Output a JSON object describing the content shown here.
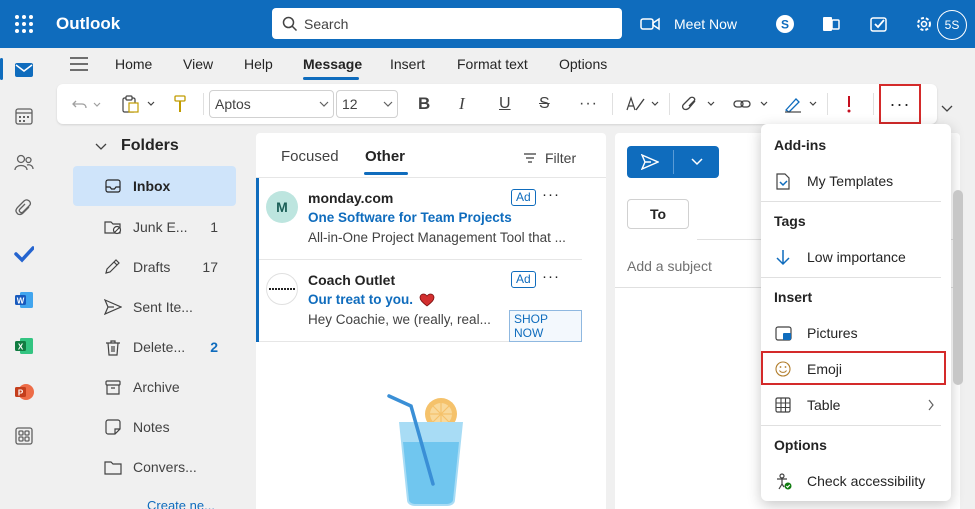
{
  "app": {
    "name": "Outlook",
    "avatar_initials": "5S"
  },
  "search": {
    "placeholder": "Search"
  },
  "topbar": {
    "meet_now": "Meet Now"
  },
  "ribbon_tabs": [
    "Home",
    "View",
    "Help",
    "Message",
    "Insert",
    "Format text",
    "Options"
  ],
  "ribbon_active_tab": "Message",
  "toolbar": {
    "font": "Aptos",
    "size": "12",
    "more": "···"
  },
  "folders": {
    "header": "Folders",
    "items": [
      {
        "label": "Inbox",
        "count": "",
        "icon": "inbox-icon"
      },
      {
        "label": "Junk E...",
        "count": "1",
        "icon": "junk-icon"
      },
      {
        "label": "Drafts",
        "count": "17",
        "icon": "drafts-icon"
      },
      {
        "label": "Sent Ite...",
        "count": "",
        "icon": "sent-icon"
      },
      {
        "label": "Delete...",
        "count": "2",
        "icon": "trash-icon"
      },
      {
        "label": "Archive",
        "count": "",
        "icon": "archive-icon"
      },
      {
        "label": "Notes",
        "count": "",
        "icon": "notes-icon"
      },
      {
        "label": "Convers...",
        "count": "",
        "icon": "folder-icon"
      }
    ],
    "create_new": "Create ne..."
  },
  "message_list": {
    "tabs": [
      "Focused",
      "Other"
    ],
    "active_tab": "Other",
    "filter": "Filter",
    "messages": [
      {
        "sender": "monday.com",
        "avatar": "M",
        "subject": "One Software for Team Projects",
        "preview": "All-in-One Project Management Tool that ...",
        "badge": "Ad",
        "more": "···"
      },
      {
        "sender": "Coach Outlet",
        "subject": "Our treat to you.",
        "preview": "Hey Coachie, we (really, real...",
        "badge": "Ad",
        "more": "···",
        "cta": "SHOP NOW"
      }
    ]
  },
  "compose": {
    "to": "To",
    "subject_placeholder": "Add a subject"
  },
  "more_menu": {
    "sections": [
      {
        "header": "Add-ins",
        "items": [
          {
            "label": "My Templates",
            "icon": "templates-icon"
          }
        ]
      },
      {
        "header": "Tags",
        "items": [
          {
            "label": "Low importance",
            "icon": "arrow-down-icon"
          }
        ]
      },
      {
        "header": "Insert",
        "items": [
          {
            "label": "Pictures",
            "icon": "pictures-icon"
          },
          {
            "label": "Emoji",
            "icon": "emoji-icon"
          },
          {
            "label": "Table",
            "icon": "table-icon"
          }
        ]
      },
      {
        "header": "Options",
        "items": [
          {
            "label": "Check accessibility",
            "icon": "accessibility-icon"
          }
        ]
      }
    ]
  },
  "colors": {
    "brand": "#0f6cbd",
    "highlight": "#d42a2a"
  }
}
